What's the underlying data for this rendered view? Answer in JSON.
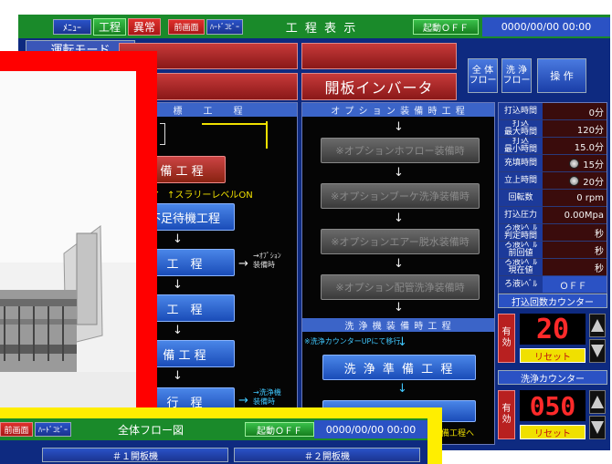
{
  "top_bar": {
    "menu": "ﾒﾆｭｰ",
    "process": "工程",
    "abnormal": "異常",
    "prev_screen": "前画面",
    "hard_copy": "ﾊｰﾄﾞｺﾋﾟｰ",
    "title": "工 程 表 示",
    "start_status": "起動ＯＦＦ",
    "datetime": "0000/00/00 00:00"
  },
  "mode_label": "運転モード",
  "inverter_label": "開板インバータ",
  "nav_buttons": {
    "overall_flow": "全 体\nフロー",
    "wash_flow": "洗 浄\nフロー",
    "operation": "操 作"
  },
  "left_panel": {
    "header": "標　　工　　程",
    "step_red": "備 工 程",
    "slurry_level": "↑スラリーレベルON",
    "shortage_wait": "不足待機工程",
    "step_b": "工　程",
    "option_note": "→ｵﾌﾟｼｮﾝ\n装備時",
    "step_c": "工　程",
    "step_d": "備 工 程",
    "step_e": "行　程",
    "wash_note": "→洗浄機\n装備時"
  },
  "middle_panel": {
    "header": "オ プ シ ョ ン 装 備 時 工 程",
    "opt1": "※オプションホフロー装備時",
    "opt2": "※オプションブーケ洗浄装備時",
    "opt3": "※オプションエアー脱水装備時",
    "opt4": "※オプション配管洗浄装備時",
    "wash_header": "洗 浄 機 装 備 時 工 程",
    "wash_note": "※洗浄カウンターUPにて移行",
    "wash_prep": "洗 浄 準 備 工 程",
    "bottom_note": "込準備工程へ"
  },
  "right_params": [
    {
      "label": "打込時間",
      "value": "0分"
    },
    {
      "label": "打込\n最大時間",
      "value": "120分"
    },
    {
      "label": "打込\n最小時間",
      "value": "15.0分"
    },
    {
      "label": "充填時間",
      "value": "15分",
      "dial": true
    },
    {
      "label": "立上時間",
      "value": "20分",
      "dial": true
    },
    {
      "label": "回転数",
      "value": "0 rpm"
    },
    {
      "label": "打込圧力",
      "value": "0.00Mpa"
    },
    {
      "label": "ろ液ﾚﾍﾞﾙ\n判定時間",
      "value": "秒"
    },
    {
      "label": "ろ液ﾚﾍﾞﾙ\n前回値",
      "value": "秒"
    },
    {
      "label": "ろ液ﾚﾍﾞﾙ\n現在値",
      "value": "秒"
    },
    {
      "label": "ろ液ﾚﾍﾞﾙ",
      "value": "ＯＦＦ"
    }
  ],
  "press_counter": {
    "title": "打込回数カウンター",
    "enable": "有\n効",
    "value": "20",
    "reset": "リセット"
  },
  "wash_counter": {
    "title": "洗浄カウンター",
    "enable": "有\n効",
    "value": "050",
    "reset": "リセット"
  },
  "overlay": {
    "prev_screen": "前画面",
    "hard_copy": "ﾊｰﾄﾞｺﾋﾟｰ",
    "title": "全体フロー図",
    "start_status": "起動ＯＦＦ",
    "datetime": "0000/00/00 00:00",
    "machine1": "＃１開板機",
    "machine2": "＃２開板機"
  },
  "colors": {
    "screen_bg": "#0e2a80",
    "overlay_red": "#ff0000",
    "overlay_yellow": "#ffee00",
    "counter_digits": "#ff2a2a"
  }
}
